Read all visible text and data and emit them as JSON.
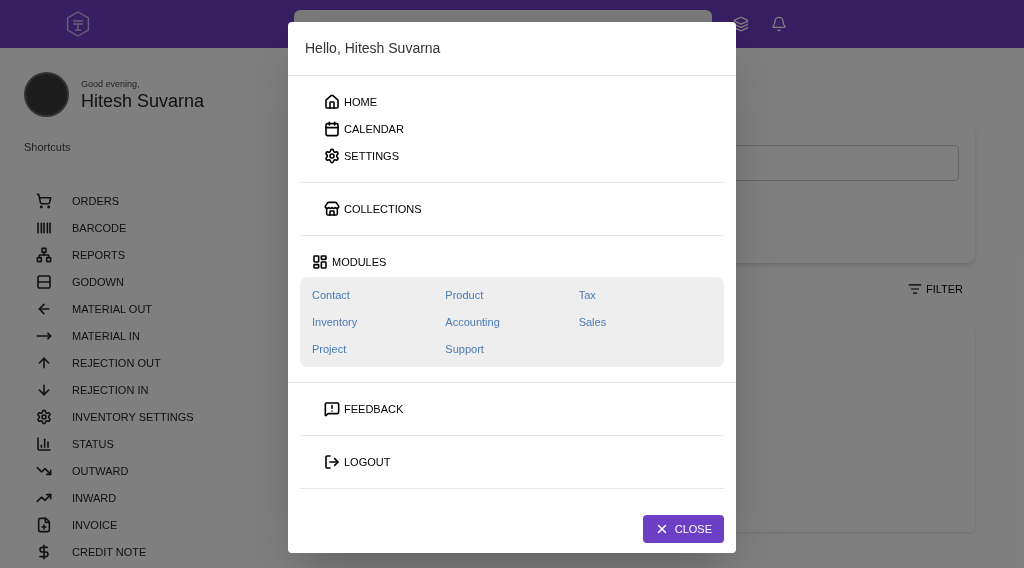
{
  "profile": {
    "greeting": "Good evening,",
    "name": "Hitesh Suvarna"
  },
  "shortcuts_label": "Shortcuts",
  "shortcuts": [
    "ORDERS",
    "BARCODE",
    "REPORTS",
    "GODOWN",
    "MATERIAL OUT",
    "MATERIAL IN",
    "REJECTION OUT",
    "REJECTION IN",
    "INVENTORY SETTINGS",
    "STATUS",
    "OUTWARD",
    "INWARD",
    "INVOICE",
    "CREDIT NOTE"
  ],
  "filter_button": "FILTER",
  "dialog": {
    "title": "Hello, Hitesh Suvarna",
    "sections": [
      {
        "kind": "links",
        "items": [
          "HOME",
          "CALENDAR",
          "SETTINGS"
        ]
      },
      {
        "kind": "links",
        "items": [
          "COLLECTIONS"
        ]
      },
      {
        "kind": "modules",
        "heading": "MODULES",
        "modules": [
          "Contact",
          "Product",
          "Tax",
          "Inventory",
          "Accounting",
          "Sales",
          "Project",
          "Support"
        ]
      },
      {
        "kind": "links",
        "items": [
          "FEEDBACK"
        ]
      },
      {
        "kind": "links",
        "items": [
          "LOGOUT"
        ]
      }
    ],
    "close_button": "CLOSE"
  }
}
